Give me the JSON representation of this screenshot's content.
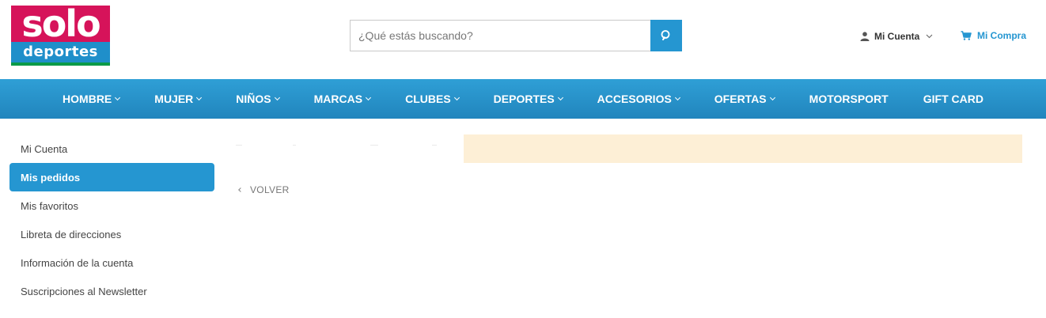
{
  "brand": {
    "logo_top": "solo",
    "logo_bottom": "deportes",
    "colors": {
      "magenta": "#d6135a",
      "blue": "#1f8fca",
      "green": "#0a9a48"
    }
  },
  "search": {
    "placeholder": "¿Qué estás buscando?",
    "value": "",
    "button_icon": "search-icon"
  },
  "header": {
    "account_label": "Mi Cuenta",
    "account_icon": "user-icon",
    "cart_label": "Mi Compra",
    "cart_icon": "cart-icon"
  },
  "nav": {
    "items": [
      {
        "label": "HOMBRE",
        "dropdown": true
      },
      {
        "label": "MUJER",
        "dropdown": true
      },
      {
        "label": "NIÑOS",
        "dropdown": true
      },
      {
        "label": "MARCAS",
        "dropdown": true
      },
      {
        "label": "CLUBES",
        "dropdown": true
      },
      {
        "label": "DEPORTES",
        "dropdown": true
      },
      {
        "label": "ACCESORIOS",
        "dropdown": true
      },
      {
        "label": "OFERTAS",
        "dropdown": true
      },
      {
        "label": "MOTORSPORT",
        "dropdown": false
      },
      {
        "label": "GIFT CARD",
        "dropdown": false
      }
    ]
  },
  "sidebar": {
    "items": [
      {
        "label": "Mi Cuenta",
        "active": false
      },
      {
        "label": "Mis pedidos",
        "active": true
      },
      {
        "label": "Mis favoritos",
        "active": false
      },
      {
        "label": "Libreta de direcciones",
        "active": false
      },
      {
        "label": "Información de la cuenta",
        "active": false
      },
      {
        "label": "Suscripciones al Newsletter",
        "active": false
      }
    ]
  },
  "content": {
    "back_label": "VOLVER",
    "notice_color": "#fdefd6"
  },
  "theme": {
    "accent": "#2596d1"
  }
}
